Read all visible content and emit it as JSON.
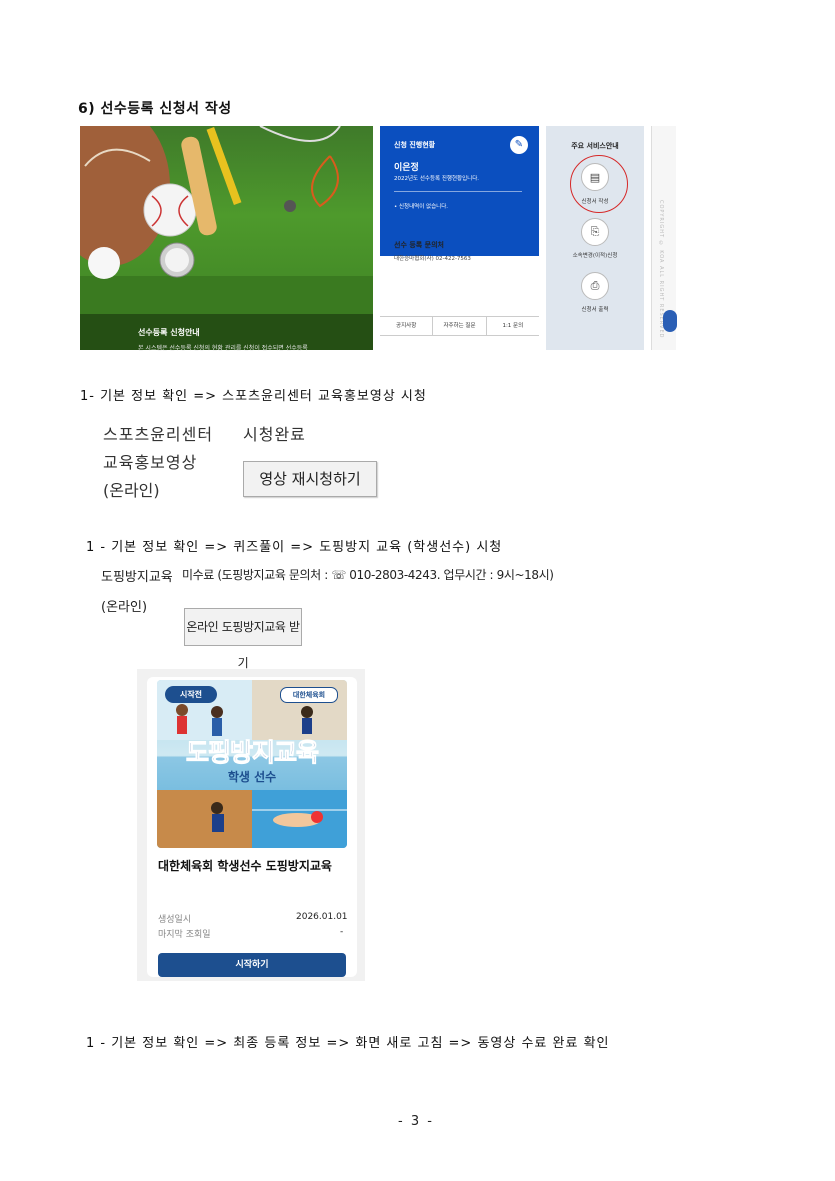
{
  "section_title": "6) 선수등록 신청서 작성",
  "screenshot": {
    "hero_caption": "선수등록 신청안내",
    "hero_sub": "본 시스템은 선수등록 신청의 현황 관리를 신청이 접수되면 선수등록",
    "status_title": "신청 진행현황",
    "status_name": "이은정",
    "status_year": "2022년도 선수등록 진행현황입니다.",
    "status_none": "• 신청내역이 없습니다.",
    "contact_title": "선수 등록 문의처",
    "contact_org": "대한승마협회(사)  02-422-7563",
    "links": [
      "공지사항",
      "자주하는 질문",
      "1:1 문의"
    ],
    "services_title": "주요 서비스안내",
    "services": [
      {
        "label": "신청서 작성",
        "icon": "document-icon"
      },
      {
        "label": "소속변경(이적)신청",
        "icon": "transfer-icon"
      },
      {
        "label": "신청서 출력",
        "icon": "printer-icon"
      }
    ],
    "right_text": "COPYRIGHT © KOA ALL RIGHT RESERVED"
  },
  "step1": "1- 기본 정보 확인 => 스포츠윤리센터 교육홍보영상 시청",
  "ethics": {
    "title": "스포츠윤리센터",
    "video": "교육홍보영상",
    "online": "(온라인)",
    "status": "시청완료",
    "button": "영상 재시청하기"
  },
  "step2": "1 - 기본 정보 확인 => 퀴즈풀이 => 도핑방지 교육 (학생선수) 시청",
  "doping": {
    "label": "도핑방지교육",
    "online": "(온라인)",
    "status": "미수료 (도핑방지교육 문의처 : ☏ 010-2803-4243. 업무시간 : 9시~18시)",
    "button": "온라인 도핑방지교육 받기"
  },
  "card": {
    "badge_start": "시작전",
    "badge_org": "대한체육회",
    "thumb_title": "도핑방지교육",
    "thumb_sub": "학생 선수",
    "title": "대한체육회 학생선수 도핑방지교육",
    "created_label": "생성일시",
    "created_value": "2026.01.01",
    "last_view_label": "마지막 조회일",
    "last_view_value": "-",
    "start_button": "시작하기"
  },
  "step3": "1 - 기본 정보 확인 => 최종 등록 정보 => 화면 새로 고침 => 동영상 수료 완료 확인",
  "page_number": "- 3 -"
}
